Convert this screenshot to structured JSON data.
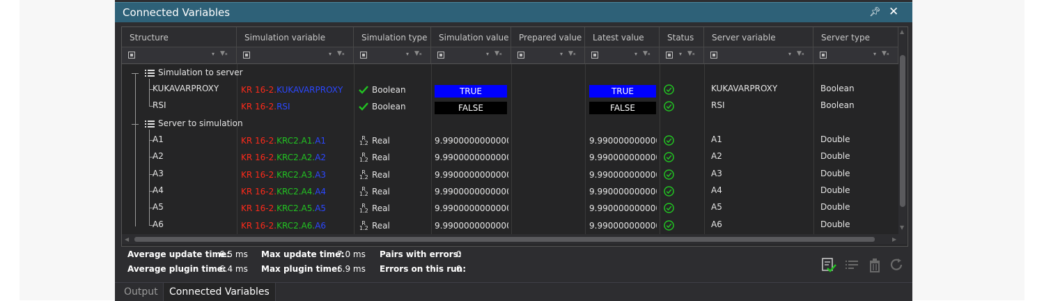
{
  "window": {
    "title": "Connected Variables"
  },
  "columns": [
    "Structure",
    "Simulation variable",
    "Simulation type",
    "Simulation value",
    "Prepared value",
    "Latest value",
    "Status",
    "Server variable",
    "Server type"
  ],
  "groups": [
    {
      "label": "Simulation to server",
      "rows": [
        {
          "name": "KUKAVARPROXY",
          "sim_var": [
            {
              "t": "KR 16-2.",
              "c": "red"
            },
            {
              "t": "KUKAVARPROXY",
              "c": "blue"
            }
          ],
          "sim_type": "Boolean",
          "type_icon": "check",
          "sim_value": "TRUE",
          "value_style": "blue",
          "latest_value": "TRUE",
          "server_var": "KUKAVARPROXY",
          "server_type": "Boolean"
        },
        {
          "name": "RSI",
          "sim_var": [
            {
              "t": "KR 16-2.",
              "c": "red"
            },
            {
              "t": "RSI",
              "c": "blue"
            }
          ],
          "sim_type": "Boolean",
          "type_icon": "check",
          "sim_value": "FALSE",
          "value_style": "black",
          "latest_value": "FALSE",
          "server_var": "RSI",
          "server_type": "Boolean"
        }
      ]
    },
    {
      "label": "Server to simulation",
      "rows": [
        {
          "name": "A1",
          "sim_var": [
            {
              "t": "KR 16-2.",
              "c": "red"
            },
            {
              "t": "KRC2.A1.",
              "c": "green"
            },
            {
              "t": "A1",
              "c": "blue"
            }
          ],
          "sim_type": "Real",
          "type_icon": "real",
          "sim_value": "9.99000000000000(",
          "latest_value": "9.9900000000000(",
          "server_var": "A1",
          "server_type": "Double"
        },
        {
          "name": "A2",
          "sim_var": [
            {
              "t": "KR 16-2.",
              "c": "red"
            },
            {
              "t": "KRC2.A2.",
              "c": "green"
            },
            {
              "t": "A2",
              "c": "blue"
            }
          ],
          "sim_type": "Real",
          "type_icon": "real",
          "sim_value": "9.99000000000000(",
          "latest_value": "9.9900000000000(",
          "server_var": "A2",
          "server_type": "Double"
        },
        {
          "name": "A3",
          "sim_var": [
            {
              "t": "KR 16-2.",
              "c": "red"
            },
            {
              "t": "KRC2.A3.",
              "c": "green"
            },
            {
              "t": "A3",
              "c": "blue"
            }
          ],
          "sim_type": "Real",
          "type_icon": "real",
          "sim_value": "9.99000000000000(",
          "latest_value": "9.9900000000000(",
          "server_var": "A3",
          "server_type": "Double"
        },
        {
          "name": "A4",
          "sim_var": [
            {
              "t": "KR 16-2.",
              "c": "red"
            },
            {
              "t": "KRC2.A4.",
              "c": "green"
            },
            {
              "t": "A4",
              "c": "blue"
            }
          ],
          "sim_type": "Real",
          "type_icon": "real",
          "sim_value": "9.99000000000000(",
          "latest_value": "9.9900000000000(",
          "server_var": "A4",
          "server_type": "Double"
        },
        {
          "name": "A5",
          "sim_var": [
            {
              "t": "KR 16-2.",
              "c": "red"
            },
            {
              "t": "KRC2.A5.",
              "c": "green"
            },
            {
              "t": "A5",
              "c": "blue"
            }
          ],
          "sim_type": "Real",
          "type_icon": "real",
          "sim_value": "9.99000000000000(",
          "latest_value": "9.9900000000000(",
          "server_var": "A5",
          "server_type": "Double"
        },
        {
          "name": "A6",
          "sim_var": [
            {
              "t": "KR 16-2.",
              "c": "red"
            },
            {
              "t": "KRC2.A6.",
              "c": "green"
            },
            {
              "t": "A6",
              "c": "blue"
            }
          ],
          "sim_type": "Real",
          "type_icon": "real",
          "sim_value": "9.99000000000000(",
          "latest_value": "9.9900000000000(",
          "server_var": "A6",
          "server_type": "Double"
        }
      ]
    }
  ],
  "real_icon_text": {
    "top": "R",
    "bottom": "1.2"
  },
  "stats": {
    "avg_update_label": "Average update time:",
    "avg_update_value": "6.5 ms",
    "avg_plugin_label": "Average plugin time:",
    "avg_plugin_value": "6.4 ms",
    "max_update_label": "Max update time:",
    "max_update_value": "7.0 ms",
    "max_plugin_label": "Max plugin time:",
    "max_plugin_value": "6.9 ms",
    "pairs_errors_label": "Pairs with errors:",
    "pairs_errors_value": "0",
    "errors_run_label": "Errors on this run:",
    "errors_run_value": "0"
  },
  "tabs": {
    "output": "Output",
    "connected": "Connected Variables"
  },
  "colors": {
    "title_bar": "#2e6178",
    "panel": "#2d2d30",
    "true_bg": "#0000ff",
    "false_bg": "#000000",
    "status_ok": "#22c422",
    "sim_var_scope": "#ff2a1a",
    "sim_var_path": "#22c422",
    "sim_var_leaf": "#2b47ff"
  },
  "icons": [
    "pin-icon",
    "close-icon",
    "filter-icon",
    "clear-filter-icon",
    "list-icon",
    "check-icon",
    "real-type-icon",
    "status-ok-icon",
    "validate-icon",
    "list-edit-icon",
    "delete-icon",
    "refresh-icon"
  ]
}
